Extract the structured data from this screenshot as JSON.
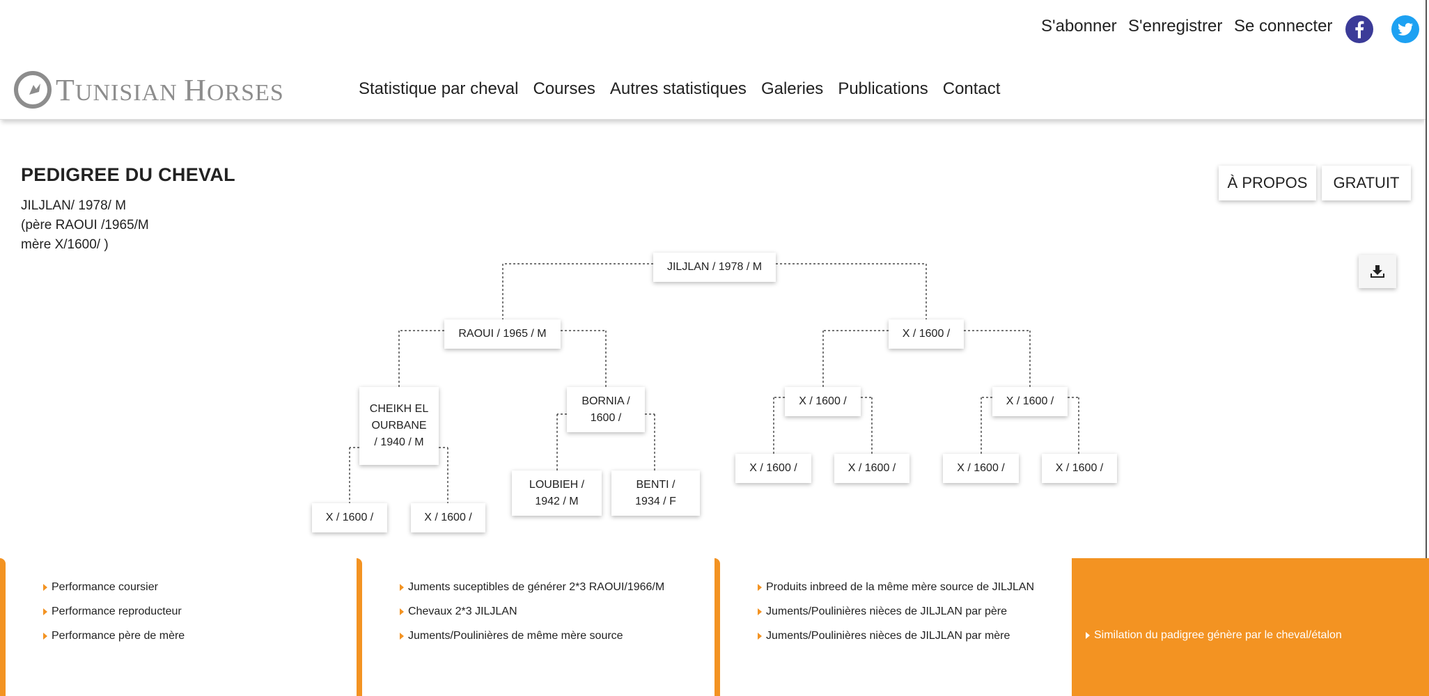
{
  "topbar": {
    "subscribe": "S'abonner",
    "register": "S'enregistrer",
    "login": "Se connecter",
    "facebook_icon": "facebook-icon",
    "twitter_icon": "twitter-icon",
    "facebook_color": "#3b3b98",
    "twitter_color": "#1da1f2"
  },
  "header": {
    "logo_text_big1": "T",
    "logo_text_small1": "UNISIAN ",
    "logo_text_big2": "H",
    "logo_text_small2": "ORSES",
    "nav": [
      "Statistique par cheval",
      "Courses",
      "Autres statistiques",
      "Galeries",
      "Publications",
      "Contact"
    ]
  },
  "page": {
    "title": "PEDIGREE DU CHEVAL",
    "info_line1": "JILJLAN/ 1978/ M",
    "info_line2": "(père RAOUI /1965/M",
    "info_line3": "mère X/1600/ )",
    "about_button": "À PROPOS",
    "free_button": "GRATUIT",
    "download_icon": "download-icon"
  },
  "tree": {
    "root": "JILJLAN / 1978 / M",
    "sire": "RAOUI / 1965 / M",
    "dam": "X / 1600 /",
    "sire_sire": "CHEIKH EL OURBANE / 1940 / M",
    "sire_dam": "BORNIA / 1600 /",
    "dam_sire": "X / 1600 /",
    "dam_dam": "X / 1600 /",
    "ss_sire": "X / 1600 /",
    "ss_dam": "X / 1600 /",
    "sd_sire": "LOUBIEH / 1942 / M",
    "sd_dam": "BENTI / 1934 / F",
    "ds_sire": "X / 1600 /",
    "ds_dam": "X / 1600 /",
    "dd_sire": "X / 1600 /",
    "dd_dam": "X / 1600 /"
  },
  "footer": {
    "col1": [
      "Performance coursier",
      "Performance reproducteur",
      "Performance père de mère"
    ],
    "col2": [
      "Juments suceptibles de générer 2*3 RAOUI/1966/M",
      "Chevaux 2*3 JILJLAN",
      "Juments/Poulinières de même mère source"
    ],
    "col3": [
      "Produits inbreed de la même mère source de JILJLAN",
      "Juments/Poulinières nièces de JILJLAN par père",
      "Juments/Poulinières nièces de JILJLAN par mère"
    ],
    "orange_item": "Similation du padigree génère par le cheval/étalon",
    "accent_color": "#f39322"
  }
}
